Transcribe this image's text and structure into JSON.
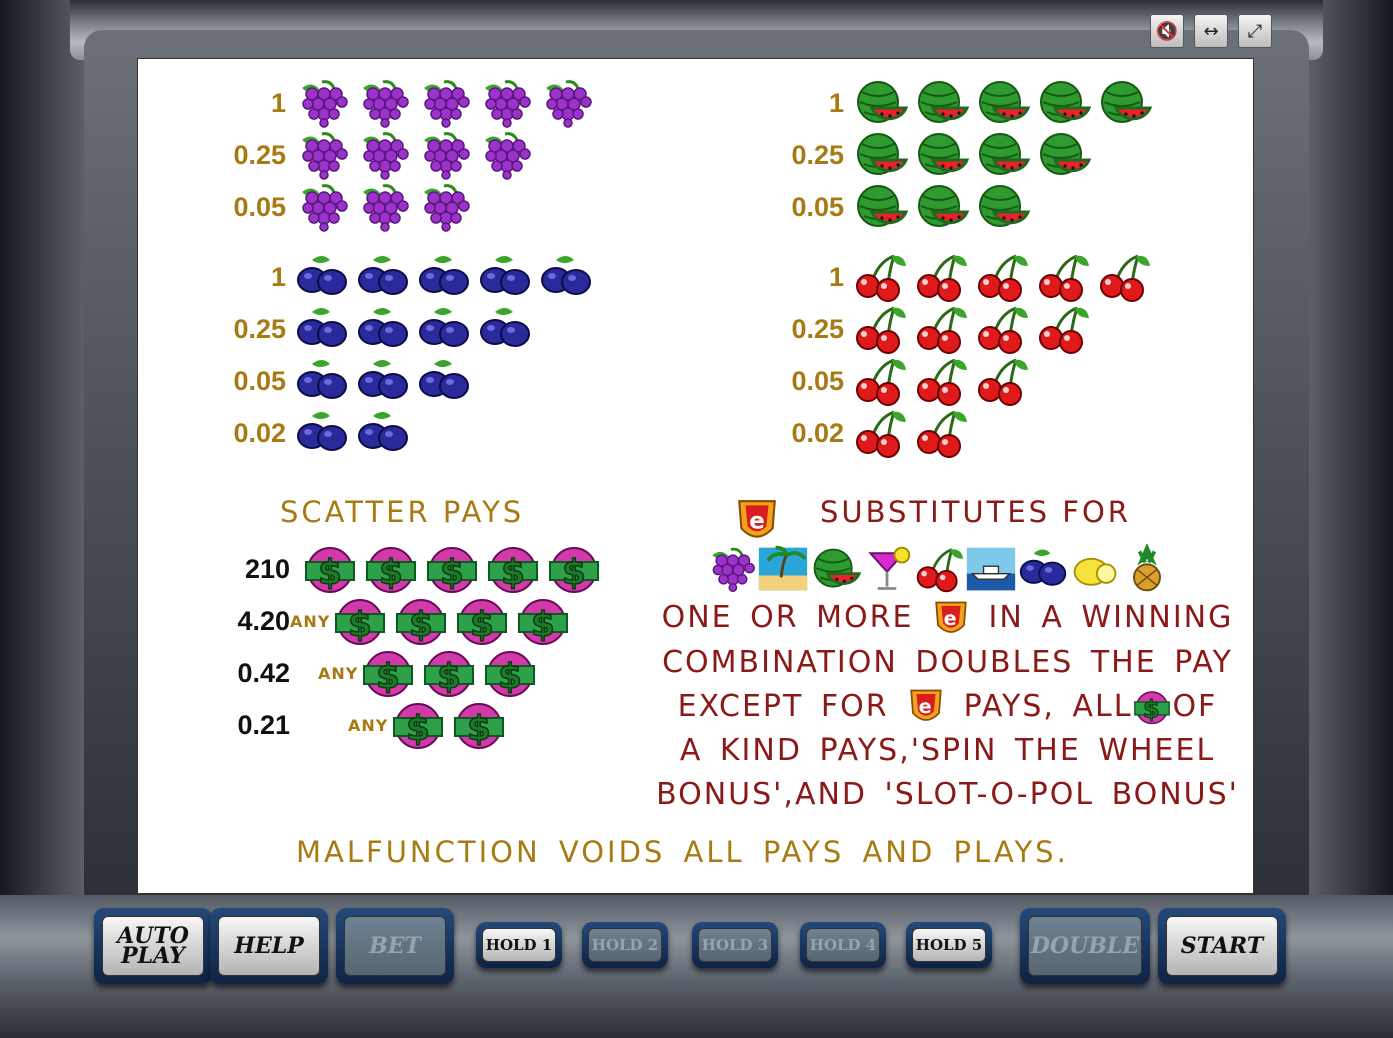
{
  "toolbar": {
    "icons": [
      "mute-icon",
      "fit-width-icon",
      "fullscreen-icon"
    ]
  },
  "paytable": {
    "grapes": {
      "symbol": "grapes",
      "rows": [
        {
          "value": "1",
          "count": 5
        },
        {
          "value": "0.25",
          "count": 4
        },
        {
          "value": "0.05",
          "count": 3
        }
      ]
    },
    "watermelon": {
      "symbol": "watermelon",
      "rows": [
        {
          "value": "1",
          "count": 5
        },
        {
          "value": "0.25",
          "count": 4
        },
        {
          "value": "0.05",
          "count": 3
        }
      ]
    },
    "plums": {
      "symbol": "plums",
      "rows": [
        {
          "value": "1",
          "count": 5
        },
        {
          "value": "0.25",
          "count": 4
        },
        {
          "value": "0.05",
          "count": 3
        },
        {
          "value": "0.02",
          "count": 2
        }
      ]
    },
    "cherries": {
      "symbol": "cherries",
      "rows": [
        {
          "value": "1",
          "count": 5
        },
        {
          "value": "0.25",
          "count": 4
        },
        {
          "value": "0.05",
          "count": 3
        },
        {
          "value": "0.02",
          "count": 2
        }
      ]
    }
  },
  "scatter": {
    "title": "SCATTER PAYS",
    "rows": [
      {
        "value": "210",
        "any": "",
        "count": 5
      },
      {
        "value": "4.20",
        "any": "ANY",
        "count": 4
      },
      {
        "value": "0.42",
        "any": "ANY",
        "count": 3
      },
      {
        "value": "0.21",
        "any": "ANY",
        "count": 2
      }
    ]
  },
  "wild": {
    "title": "SUBSTITUTES FOR",
    "substitutes": [
      "grapes",
      "island",
      "watermelon",
      "cocktail",
      "cherries",
      "yacht",
      "plum",
      "lemon",
      "pineapple"
    ],
    "line1a": "ONE OR MORE",
    "line1b": "IN A WINNING",
    "line2": "COMBINATION DOUBLES THE PAY",
    "line3a": "EXCEPT FOR",
    "line3b": "PAYS, ALL",
    "line3c": "OF",
    "line4": "A KIND PAYS,'SPIN THE WHEEL",
    "line5": "BONUS',AND 'SLOT-O-POL BONUS'"
  },
  "footer": "MALFUNCTION VOIDS ALL PAYS AND PLAYS.",
  "controls": {
    "autoplay_line1": "AUTO",
    "autoplay_line2": "PLAY",
    "help": "HELP",
    "bet": "BET",
    "hold1": "HOLD 1",
    "hold2": "HOLD 2",
    "hold3": "HOLD 3",
    "hold4": "HOLD 4",
    "hold5": "HOLD 5",
    "double": "DOUBLE",
    "start": "START"
  },
  "colors": {
    "gold": "#a87a14",
    "red_text": "#8a1a18",
    "screen": "#ffffff"
  }
}
